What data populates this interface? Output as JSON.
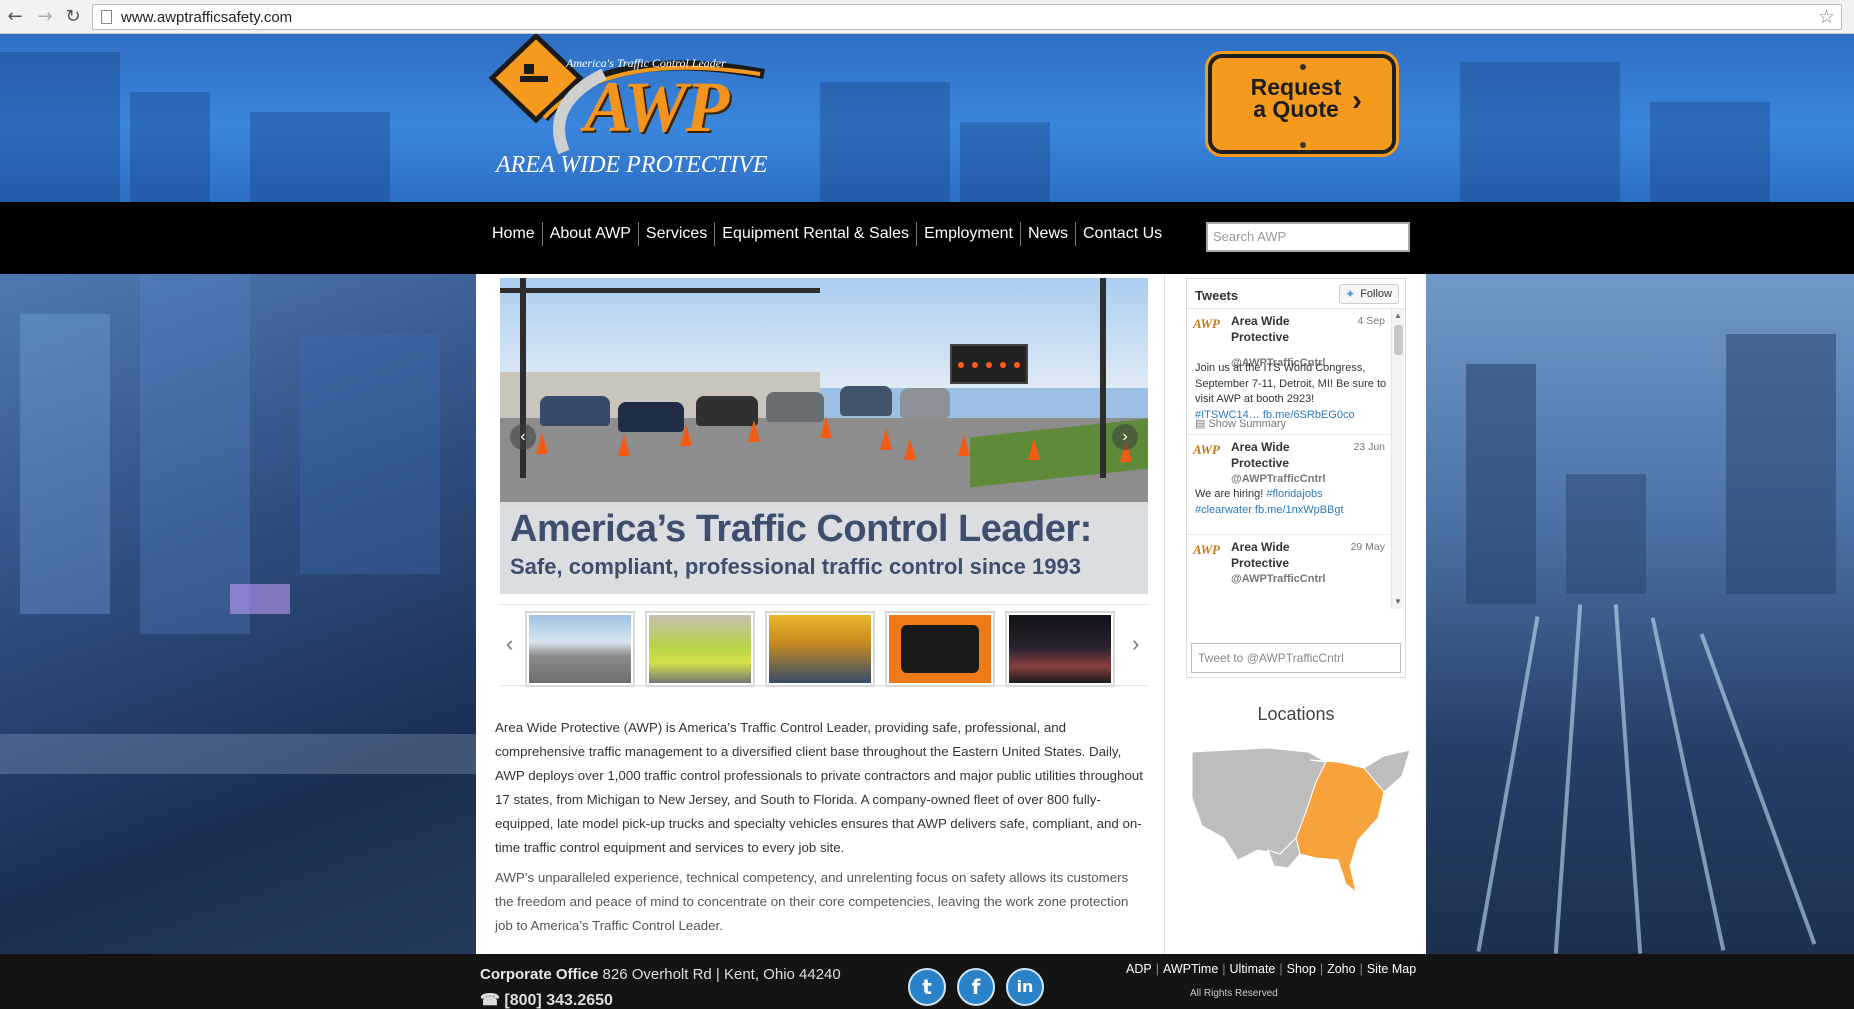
{
  "browser": {
    "url": "www.awptrafficsafety.com"
  },
  "header": {
    "logo_tagline": "America's Traffic Control Leader",
    "logo_name": "AWP",
    "logo_sub": "AREA WIDE PROTECTIVE",
    "quote_button_line1": "Request",
    "quote_button_line2": "a Quote",
    "quote_button_chevron": "›"
  },
  "nav": {
    "items": [
      {
        "label": "Home"
      },
      {
        "label": "About AWP"
      },
      {
        "label": "Services"
      },
      {
        "label": "Equipment Rental & Sales"
      },
      {
        "label": "Employment"
      },
      {
        "label": "News"
      },
      {
        "label": "Contact Us"
      }
    ],
    "search_placeholder": "Search AWP"
  },
  "slider": {
    "headline": "America’s Traffic Control Leader:",
    "subline": "Safe, compliant, professional traffic control since 1993",
    "prev": "‹",
    "next": "›"
  },
  "thumbnails": {
    "prev": "‹",
    "next": "›"
  },
  "body": {
    "paragraph1": "Area Wide Protective (AWP) is America’s Traffic Control Leader, providing safe, professional, and comprehensive traffic management to a diversified client base throughout the Eastern United States. Daily, AWP deploys over 1,000 traffic control professionals to private contractors and major public utilities throughout 17 states, from Michigan to New Jersey, and South to Florida. A company-owned fleet of over 800 fully-equipped, late model pick-up trucks and specialty vehicles ensures that AWP delivers safe, compliant, and on-time traffic control equipment and services to every job site.",
    "paragraph2": "AWP’s unparalleled experience, technical competency, and unrelenting focus on safety allows its customers the freedom and peace of mind to concentrate on their core competencies, leaving the work zone protection job to America’s Traffic Control Leader."
  },
  "tweets": {
    "title": "Tweets",
    "follow_label": "Follow",
    "items": [
      {
        "author": "Area Wide Protective",
        "date": "4 Sep",
        "handle": "@AWPTrafficCntrl",
        "text": "Join us at the ITS World Congress, September 7-11, Detroit, MI! Be sure to visit AWP at booth 2923!",
        "links": "#ITSWC14… fb.me/6SRbEG0co",
        "summary": "Show Summary"
      },
      {
        "author": "Area Wide Protective",
        "date": "23 Jun",
        "handle": "@AWPTrafficCntrl",
        "text": "We are hiring!",
        "links1": "#floridajobs",
        "links2": "#clearwater fb.me/1nxWpBBgt"
      },
      {
        "author": "Area Wide Protective",
        "date": "29 May",
        "handle": "@AWPTrafficCntrl"
      }
    ],
    "composer_placeholder": "Tweet to @AWPTrafficCntrl",
    "avatar_text": "AWP"
  },
  "locations": {
    "title": "Locations"
  },
  "footer": {
    "corp_label": "Corporate Office",
    "corp_address": "826 Overholt Rd | Kent, Ohio 44240",
    "phone": "[800] 343.2650",
    "links": [
      "ADP",
      "AWPTime",
      "Ultimate",
      "Shop",
      "Zoho",
      "Site Map"
    ],
    "rights": "All Rights Reserved"
  },
  "colors": {
    "brand_orange": "#f59a1c",
    "header_blue": "#3a86dc",
    "nav_black": "#000000",
    "map_highlight": "#f7a23a",
    "map_base": "#bdbdbd"
  },
  "icons": {
    "back": "back-arrow-icon",
    "forward": "forward-arrow-icon",
    "reload": "reload-icon",
    "bookmark": "star-icon",
    "twitter": "twitter-icon",
    "facebook": "facebook-icon",
    "linkedin": "linkedin-icon",
    "phone": "phone-icon"
  }
}
